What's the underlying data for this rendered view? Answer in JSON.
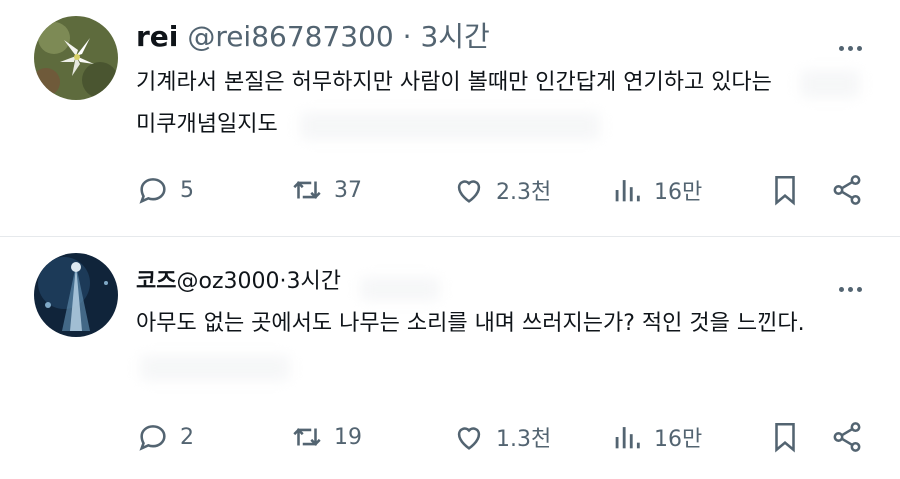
{
  "posts": [
    {
      "name": "rei",
      "handle": "@rei86787300",
      "separator": "·",
      "time": "3시간",
      "text_line1": "기계라서 본질은 허무하지만 사람이 볼때만 인간답게 연기하고 있다는",
      "text_line2": "미쿠개념일지도",
      "replies": "5",
      "reposts": "37",
      "likes": "2.3천",
      "views": "16만"
    },
    {
      "name": "코즈",
      "handle": "@oz3000",
      "separator": "·",
      "time": "3시간",
      "text_line1": "아무도 없는 곳에서도 나무는 소리를 내며 쓰러지는가? 적인 것을 느낀다.",
      "replies": "2",
      "reposts": "19",
      "likes": "1.3천",
      "views": "16만"
    }
  ],
  "icons": {
    "reply": "speech-bubble-icon",
    "repost": "repost-arrows-icon",
    "like": "heart-icon",
    "views": "bar-chart-icon",
    "bookmark": "bookmark-icon",
    "share": "share-icon",
    "more": "more-dots-icon"
  },
  "colors": {
    "muted": "#536471",
    "text": "#0f1419",
    "divider": "#e6e9ec"
  }
}
